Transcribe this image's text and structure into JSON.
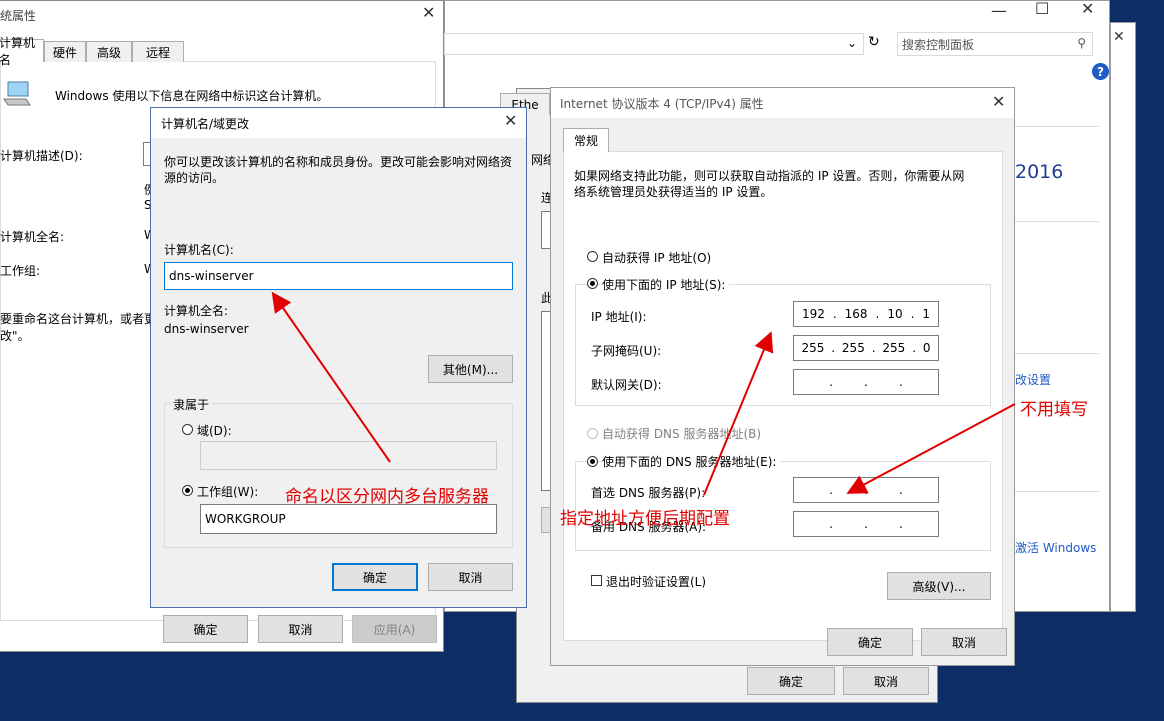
{
  "sysprop": {
    "title": "统属性",
    "tabs": [
      "计算机名",
      "硬件",
      "高级",
      "远程"
    ],
    "info": "Windows 使用以下信息在网络中标识这台计算机。",
    "desc_label": "计算机描述(D):",
    "frag1": "例",
    "frag2": "S",
    "fullname_label": "计算机全名:",
    "fullname_frag": "W",
    "workgroup_label": "工作组:",
    "workgroup_frag": "W",
    "rename_text_1": "要重命名这台计算机，或者更",
    "rename_text_2": "改\"。",
    "ok": "确定",
    "cancel": "取消",
    "apply": "应用(A)"
  },
  "cpanel": {
    "search_placeholder": "搜索控制面板",
    "year": "2016",
    "link1": "改设置",
    "link2": "激活 Windows",
    "help": "?"
  },
  "ethernet": {
    "tab1": "Ethe",
    "label1": "网络",
    "label2": "连",
    "label3": "此",
    "ok": "确定",
    "cancel": "取消"
  },
  "namechange": {
    "title": "计算机名/域更改",
    "desc": "你可以更改该计算机的名称和成员身份。更改可能会影响对网络资源的访问。",
    "name_label": "计算机名(C):",
    "name_value": "dns-winserver",
    "fullname_label": "计算机全名:",
    "fullname_value": "dns-winserver",
    "other_btn": "其他(M)...",
    "member_of": "隶属于",
    "domain_label": "域(D):",
    "workgroup_label": "工作组(W):",
    "workgroup_value": "WORKGROUP",
    "ok": "确定",
    "cancel": "取消"
  },
  "ipv4": {
    "title": "Internet 协议版本 4 (TCP/IPv4) 属性",
    "tab": "常规",
    "desc": "如果网络支持此功能，则可以获取自动指派的 IP 设置。否则，你需要从网络系统管理员处获得适当的 IP 设置。",
    "auto_ip": "自动获得 IP 地址(O)",
    "use_ip": "使用下面的 IP 地址(S):",
    "ip_label": "IP 地址(I):",
    "ip_value": [
      "192",
      "168",
      "10",
      "1"
    ],
    "mask_label": "子网掩码(U):",
    "mask_value": [
      "255",
      "255",
      "255",
      "0"
    ],
    "gw_label": "默认网关(D):",
    "auto_dns": "自动获得 DNS 服务器地址(B)",
    "use_dns": "使用下面的 DNS 服务器地址(E):",
    "pref_dns": "首选 DNS 服务器(P):",
    "alt_dns": "备用 DNS 服务器(A):",
    "validate": "退出时验证设置(L)",
    "advanced": "高级(V)...",
    "ok": "确定",
    "cancel": "取消"
  },
  "annotations": {
    "a1": "命名以区分网内多台服务器",
    "a2": "指定地址方便后期配置",
    "a3": "不用填写"
  }
}
